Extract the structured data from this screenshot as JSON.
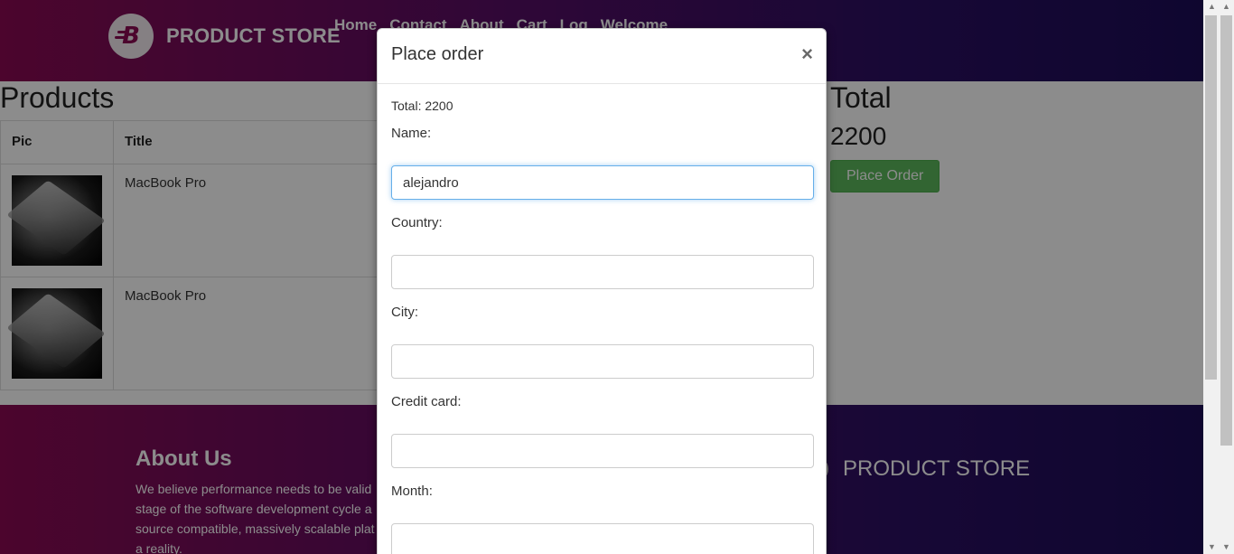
{
  "navbar": {
    "brand": "PRODUCT STORE",
    "links": [
      "Home",
      "Contact",
      "About",
      "Cart",
      "Log",
      "Welcome"
    ]
  },
  "products": {
    "title": "Products",
    "columns": [
      "Pic",
      "Title"
    ],
    "rows": [
      {
        "title": "MacBook Pro"
      },
      {
        "title": "MacBook Pro"
      }
    ]
  },
  "total": {
    "title": "Total",
    "value": "2200",
    "button": "Place Order"
  },
  "footer": {
    "about_title": "About Us",
    "about_lines": [
      "We believe performance needs to be valid",
      "stage of the software development cycle a",
      "source compatible, massively scalable plat",
      "a reality."
    ],
    "brand": "PRODUCT STORE"
  },
  "modal": {
    "title": "Place order",
    "close": "×",
    "total_text": "Total: 2200",
    "fields": {
      "name": {
        "label": "Name:",
        "value": "alejandro"
      },
      "country": {
        "label": "Country:",
        "value": ""
      },
      "city": {
        "label": "City:",
        "value": ""
      },
      "card": {
        "label": "Credit card:",
        "value": ""
      },
      "month": {
        "label": "Month:",
        "value": ""
      }
    }
  },
  "colors": {
    "gradient_start": "#8a0a52",
    "gradient_end": "#1c0c57",
    "success": "#5cb85c",
    "focus": "#66afe9"
  }
}
